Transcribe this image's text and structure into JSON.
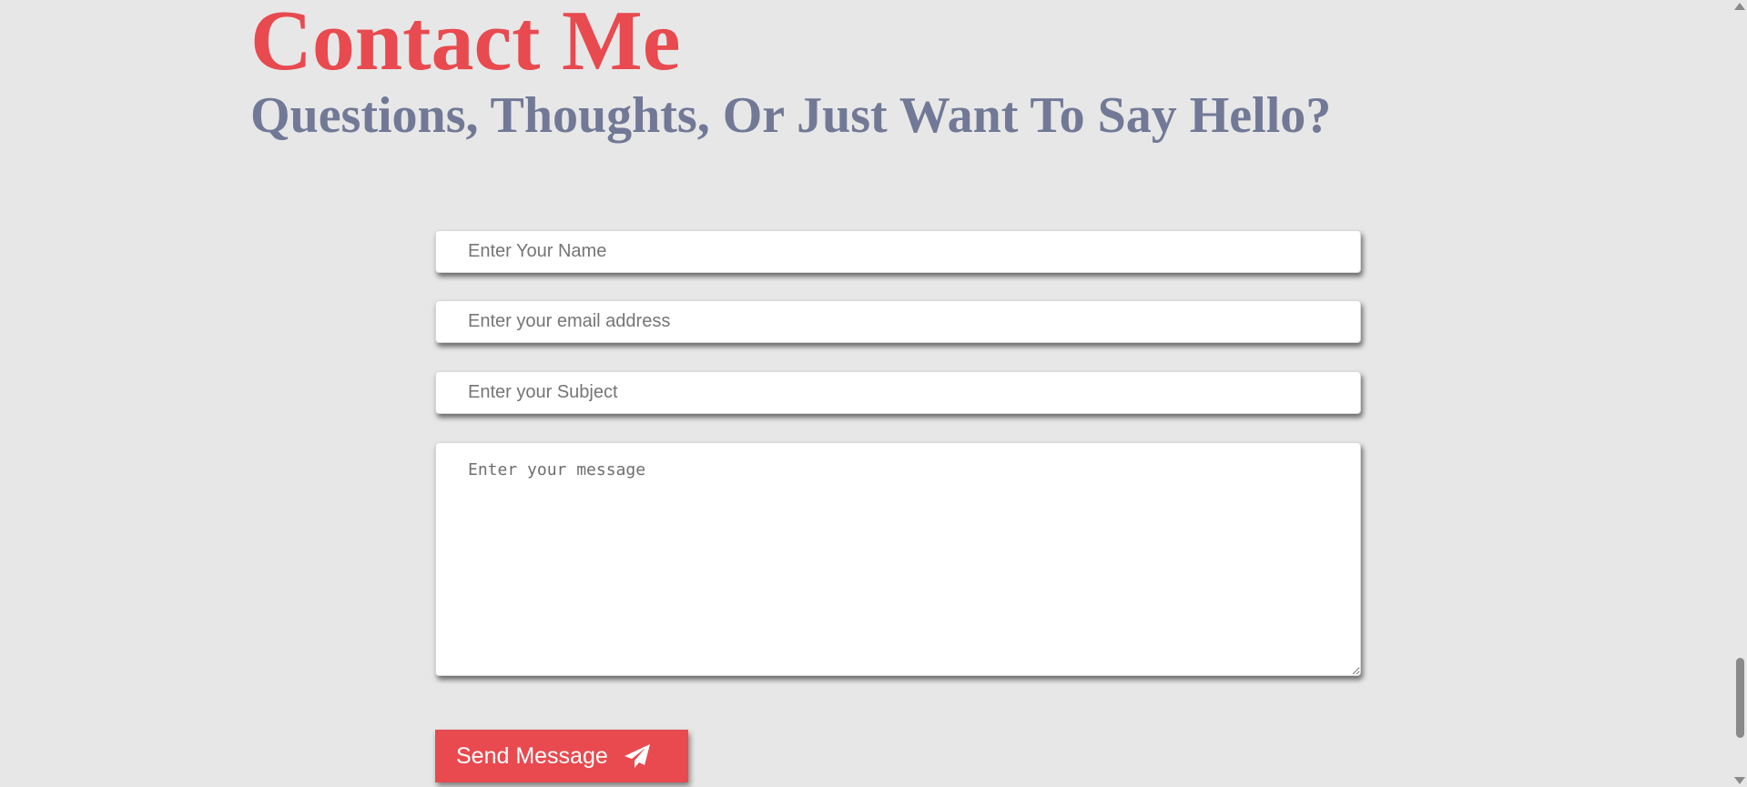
{
  "header": {
    "title": "Contact Me",
    "subtitle": "Questions, Thoughts, Or Just Want To Say Hello?"
  },
  "form": {
    "name_placeholder": "Enter Your Name",
    "email_placeholder": "Enter your email address",
    "subject_placeholder": "Enter your Subject",
    "message_placeholder": "Enter your message",
    "send_label": "Send Message",
    "send_icon": "paper-plane-icon"
  },
  "colors": {
    "accent": "#e84a4f",
    "subtitle": "#727996",
    "background": "#e7e7e7"
  },
  "scrollbar": {
    "position_fraction": 0.92
  }
}
